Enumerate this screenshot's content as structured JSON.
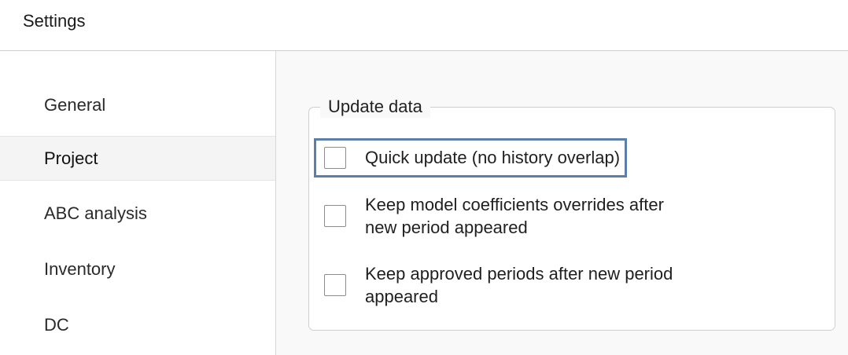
{
  "window": {
    "title": "Settings"
  },
  "sidebar": {
    "items": [
      {
        "label": "General",
        "active": false
      },
      {
        "label": "Project",
        "active": true
      },
      {
        "label": "ABC analysis",
        "active": false
      },
      {
        "label": "Inventory",
        "active": false
      },
      {
        "label": "DC",
        "active": false
      }
    ]
  },
  "content": {
    "group": {
      "legend": "Update data",
      "options": [
        {
          "label": "Quick update (no history overlap)",
          "checked": false,
          "focused": true
        },
        {
          "label": "Keep model coefficients overrides after new period appeared",
          "checked": false,
          "focused": false
        },
        {
          "label": "Keep approved periods after new period appeared",
          "checked": false,
          "focused": false
        }
      ]
    }
  },
  "colors": {
    "focus_outline": "#5b7fa8",
    "active_item_bg": "#f4f4f4",
    "content_bg": "#f9f9f9"
  }
}
